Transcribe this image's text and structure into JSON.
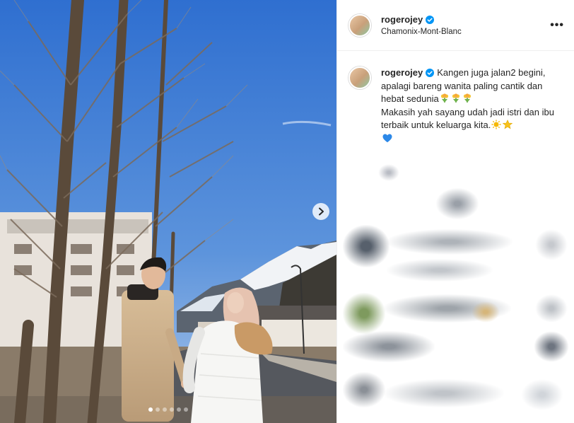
{
  "post": {
    "username": "rogerojey",
    "location": "Chamonix-Mont-Blanc",
    "more_label": "•••",
    "caption": {
      "username": "rogerojey",
      "line1": "Kangen juga jalan2 begini, apalagi bareng wanita paling cantik dan hebat sedunia",
      "line2": "Makasih yah sayang udah jadi istri dan ibu terbaik untuk keluarga kita."
    },
    "icons": {
      "verified": "verified-badge-icon",
      "more": "more-options-icon",
      "next": "chevron-right-icon",
      "emoji_1": "tulip-bouquet-emoji",
      "emoji_2": "sun-emoji",
      "emoji_3": "star-emoji",
      "emoji_4": "blue-heart-emoji"
    },
    "carousel": {
      "slide_count": 6,
      "active_index": 0
    }
  },
  "colors": {
    "verified_blue": "#0095f6",
    "text": "#262626",
    "border": "#efefef"
  }
}
